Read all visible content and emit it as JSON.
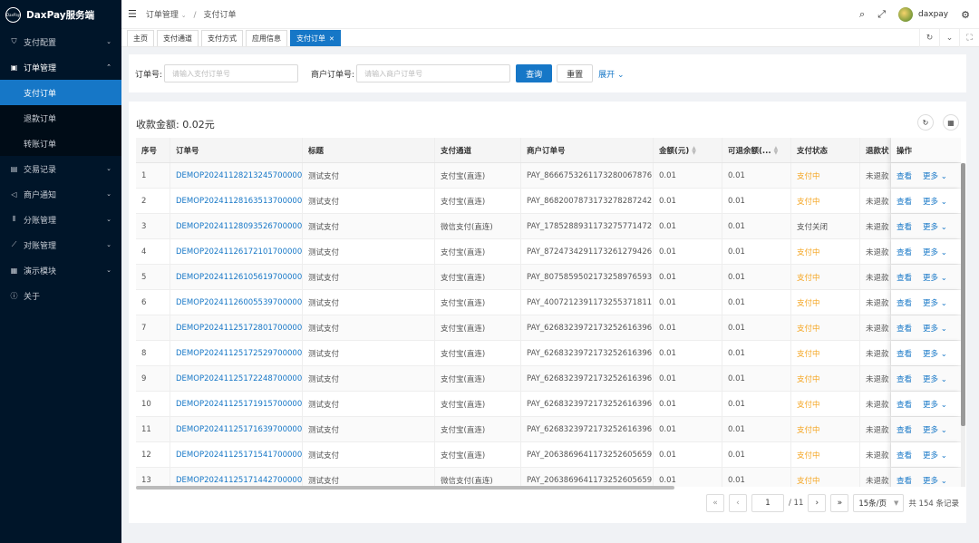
{
  "app": {
    "logo_text": "DaxPay",
    "title": "DaxPay服务端"
  },
  "sidebar": {
    "items": [
      {
        "label": "支付配置",
        "icon": "shield-icon"
      },
      {
        "label": "订单管理",
        "icon": "order-icon"
      },
      {
        "label": "交易记录",
        "icon": "record-icon"
      },
      {
        "label": "商户通知",
        "icon": "megaphone-icon"
      },
      {
        "label": "分账管理",
        "icon": "split-icon"
      },
      {
        "label": "对账管理",
        "icon": "reconcile-icon"
      },
      {
        "label": "演示模块",
        "icon": "grid-icon"
      },
      {
        "label": "关于",
        "icon": "info-icon"
      }
    ],
    "sub": [
      "支付订单",
      "退款订单",
      "转账订单"
    ]
  },
  "header": {
    "breadcrumb": [
      "订单管理",
      "支付订单"
    ],
    "username": "daxpay"
  },
  "tabs": [
    "主页",
    "支付通道",
    "支付方式",
    "应用信息",
    "支付订单"
  ],
  "search": {
    "order_label": "订单号:",
    "order_placeholder": "请输入支付订单号",
    "merchant_label": "商户订单号:",
    "merchant_placeholder": "请输入商户订单号",
    "query": "查询",
    "reset": "重置",
    "expand": "展开"
  },
  "summary": {
    "total": "收款金额: 0.02元"
  },
  "table": {
    "columns": [
      "序号",
      "订单号",
      "标题",
      "支付通道",
      "商户订单号",
      "金额(元)",
      "可退余额(...",
      "支付状态",
      "退款状",
      "操作"
    ],
    "view": "查看",
    "more": "更多",
    "rows": [
      [
        "1",
        "DEMOP20241128213245700000...",
        "测试支付",
        "支付宝(直连)",
        "PAY_8666753261173280067876",
        "0.01",
        "0.01",
        "支付中",
        "未退款"
      ],
      [
        "2",
        "DEMOP20241128163513700000...",
        "测试支付",
        "支付宝(直连)",
        "PAY_8682007873173278287242",
        "0.01",
        "0.01",
        "支付中",
        "未退款"
      ],
      [
        "3",
        "DEMOP20241128093526700000...",
        "测试支付",
        "微信支付(直连)",
        "PAY_1785288931173275771472",
        "0.01",
        "0.01",
        "支付关闭",
        "未退款"
      ],
      [
        "4",
        "DEMOP20241126172101700000...",
        "测试支付",
        "支付宝(直连)",
        "PAY_8724734291173261279426",
        "0.01",
        "0.01",
        "支付中",
        "未退款"
      ],
      [
        "5",
        "DEMOP20241126105619700000...",
        "测试支付",
        "支付宝(直连)",
        "PAY_8075859502173258976593",
        "0.01",
        "0.01",
        "支付中",
        "未退款"
      ],
      [
        "6",
        "DEMOP20241126005539700000...",
        "测试支付",
        "支付宝(直连)",
        "PAY_4007212391173255371811",
        "0.01",
        "0.01",
        "支付中",
        "未退款"
      ],
      [
        "7",
        "DEMOP20241125172801700000...",
        "测试支付",
        "支付宝(直连)",
        "PAY_6268323972173252616396",
        "0.01",
        "0.01",
        "支付中",
        "未退款"
      ],
      [
        "8",
        "DEMOP20241125172529700000...",
        "测试支付",
        "支付宝(直连)",
        "PAY_6268323972173252616396",
        "0.01",
        "0.01",
        "支付中",
        "未退款"
      ],
      [
        "9",
        "DEMOP20241125172248700000...",
        "测试支付",
        "支付宝(直连)",
        "PAY_6268323972173252616396",
        "0.01",
        "0.01",
        "支付中",
        "未退款"
      ],
      [
        "10",
        "DEMOP20241125171915700000...",
        "测试支付",
        "支付宝(直连)",
        "PAY_6268323972173252616396",
        "0.01",
        "0.01",
        "支付中",
        "未退款"
      ],
      [
        "11",
        "DEMOP20241125171639700000...",
        "测试支付",
        "支付宝(直连)",
        "PAY_6268323972173252616396",
        "0.01",
        "0.01",
        "支付中",
        "未退款"
      ],
      [
        "12",
        "DEMOP20241125171541700000...",
        "测试支付",
        "支付宝(直连)",
        "PAY_2063869641173252605659",
        "0.01",
        "0.01",
        "支付中",
        "未退款"
      ],
      [
        "13",
        "DEMOP20241125171442700000...",
        "测试支付",
        "微信支付(直连)",
        "PAY_2063869641173252605659",
        "0.01",
        "0.01",
        "支付中",
        "未退款"
      ]
    ]
  },
  "pagination": {
    "current": "1",
    "total_pages": "/ 11",
    "page_size": "15条/页",
    "total_records": "共 154 条记录"
  },
  "colors": {
    "primary": "#1677c7",
    "sidebar_bg": "#001529",
    "status_paying": "#f5a623"
  }
}
